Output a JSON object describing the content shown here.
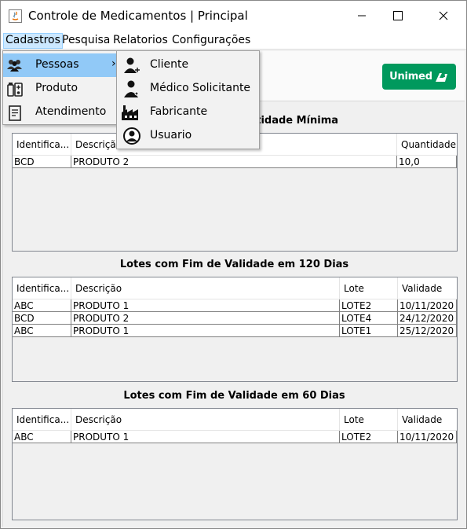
{
  "window": {
    "title": "Controle de Medicamentos | Principal"
  },
  "menubar": {
    "items": [
      "Cadastros",
      "Pesquisa",
      "Relatorios",
      "Configurações"
    ]
  },
  "cadastros_menu": {
    "items": [
      "Pessoas",
      "Produto",
      "Atendimento"
    ],
    "submenu_arrow": "›"
  },
  "pessoas_submenu": {
    "items": [
      "Cliente",
      "Médico Solicitante",
      "Fabricante",
      "Usuario"
    ]
  },
  "logo": {
    "text": "Unimed",
    "color": "#00995d"
  },
  "section1": {
    "title_visible": "ntidade Mínima",
    "columns": [
      "Identifica...",
      "Descrição",
      "Quantidade"
    ],
    "rows": [
      [
        "BCD",
        "PRODUTO 2",
        "10,0"
      ]
    ]
  },
  "section2": {
    "title": "Lotes com Fim de Validade em 120 Dias",
    "columns": [
      "Identifica...",
      "Descrição",
      "Lote",
      "Validade"
    ],
    "rows": [
      [
        "ABC",
        "PRODUTO 1",
        "LOTE2",
        "10/11/2020"
      ],
      [
        "BCD",
        "PRODUTO 2",
        "LOTE4",
        "24/12/2020"
      ],
      [
        "ABC",
        "PRODUTO 1",
        "LOTE1",
        "25/12/2020"
      ]
    ]
  },
  "section3": {
    "title": "Lotes com Fim de Validade em 60 Dias",
    "columns": [
      "Identifica...",
      "Descrição",
      "Lote",
      "Validade"
    ],
    "rows": [
      [
        "ABC",
        "PRODUTO 1",
        "LOTE2",
        "10/11/2020"
      ]
    ]
  }
}
